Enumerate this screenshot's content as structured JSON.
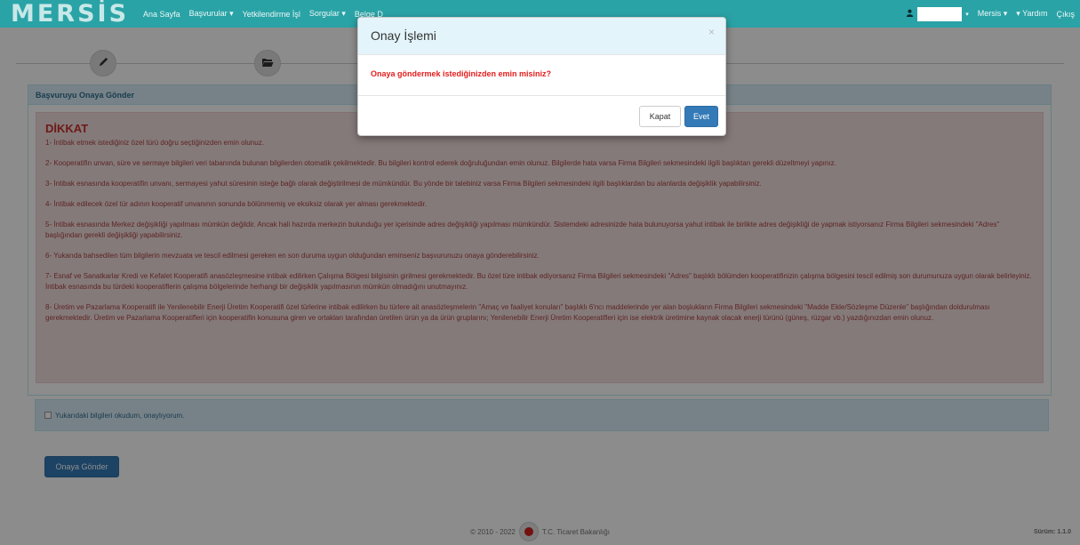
{
  "navbar": {
    "logo": "MERSİS",
    "items": [
      "Ana Sayfa",
      "Başvurular ▾",
      "Yetkilendirme İşl",
      "Sorgular ▾",
      "Belge D"
    ],
    "user_caret": "▾",
    "right_items": [
      "Mersis ▾",
      "▾ Yardım",
      "Çıkış"
    ]
  },
  "panel": {
    "title": "Başvuruyu Onaya Gönder",
    "alert_title": "DİKKAT",
    "paragraphs": [
      "1- İntibak etmek istediğiniz özel türü doğru seçtiğinizden emin olunuz.",
      "2- Kooperatifin unvan, süre ve sermaye bilgileri veri tabanında bulunan bilgilerden otomatik çekilmektedir. Bu bilgileri kontrol ederek doğruluğundan emin olunuz. Bilgilerde hata varsa Firma Bilgileri sekmesindeki ilgili başlıktan gerekli düzeltmeyi yapınız.",
      "3- İntibak esnasında kooperatifin unvanı, sermayesi yahut süresinin isteğe bağlı olarak değiştirilmesi de mümkündür. Bu yönde bir talebiniz varsa Firma Bilgileri sekmesindeki ilgili başlıklardan bu alanlarda değişiklik yapabilirsiniz.",
      "4- İntibak edilecek özel tür adının kooperatif unvanının sonunda bölünmemiş ve eksiksiz olarak yer alması gerekmektedir.",
      "5- İntibak esnasında Merkez değişikliği yapılması mümkün değildir. Ancak hali hazırda merkezin bulunduğu yer içerisinde adres değişikliği yapılması mümkündür. Sistemdeki adresinizde hata bulunuyorsa yahut intibak ile birlikte adres değişikliği de yapmak istiyorsanız Firma Bilgileri sekmesindeki \"Adres\" başlığından gerekli değişikliği yapabilirsiniz.",
      "6- Yukarıda bahsedilen tüm bilgilerin mevzuata ve tescil edilmesi gereken en son duruma uygun olduğundan eminseniz başvurunuzu onaya gönderebilirsiniz.",
      "7- Esnaf ve Sanatkarlar Kredi ve Kefalet Kooperatifi anasözleşmesine intibak edilirken Çalışma Bölgesi bilgisinin girilmesi gerekmektedir. Bu özel türe intibak ediyorsanız Firma Bilgileri sekmesindeki \"Adres\" başlıklı bölümden kooperatifinizin çalışma bölgesini tescil edilmiş son durumunuza uygun olarak belirleyiniz. İntibak esnasında bu türdeki kooperatiflerin çalışma bölgelerinde herhangi bir değişiklik yapılmasının mümkün olmadığını unutmayınız.",
      "8- Üretim ve Pazarlama Kooperatifi ile Yenilenebilir Enerji Üretim Kooperatifi özel türlerine intibak edilirken bu türlere ait anasözleşmelerin \"Amaç ve faaliyet konuları\" başlıklı 6'ncı maddelerinde yer alan boşlukların Firma Bilgileri sekmesindeki \"Madde Ekle/Sözleşme Düzenle\" başlığından doldurulması gerekmektedir. Üretim ve Pazarlama Kooperatifleri için kooperatifin konusuna giren ve ortakları tarafından üretilen ürün ya da ürün gruplarını; Yenilenebilir Enerji Üretim Kooperatifleri için ise elektrik üretimine kaynak olacak enerji türünü (güneş, rüzgar vb.) yazdığınızdan emin olunuz."
    ],
    "confirm_label": "Yukarıdaki bilgileri okudum, onaylıyorum.",
    "send_button": "Onaya Gönder"
  },
  "footer": {
    "copyright": "© 2010 - 2022",
    "ministry": "T.C. Ticaret Bakanlığı",
    "version": "Sürüm: 1.1.0"
  },
  "modal": {
    "title": "Onay İşlemi",
    "close": "×",
    "message": "Onaya göndermek istediğinizden emin misiniz?",
    "cancel": "Kapat",
    "confirm": "Evet"
  },
  "icons": {
    "step1": "pencil-icon",
    "step2": "folder-open-icon",
    "user": "user-icon"
  },
  "colors": {
    "navbar": "#2aa3a6",
    "primary": "#337ab7",
    "danger_text": "#a94442",
    "danger_bg": "#f2dede",
    "info_bg": "#d9edf7"
  }
}
